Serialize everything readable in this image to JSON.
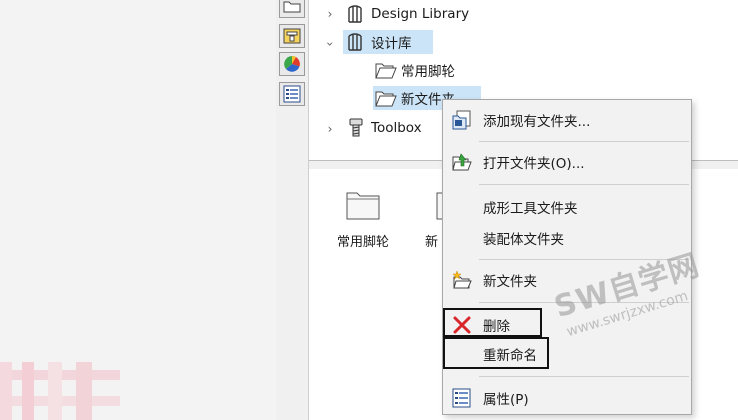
{
  "tree": {
    "items": [
      {
        "label": "Design Library",
        "expanded": false
      },
      {
        "label": "设计库",
        "expanded": true
      },
      {
        "label": "常用脚轮"
      },
      {
        "label": "新文件夹"
      },
      {
        "label": "Toolbox",
        "expanded": false
      }
    ]
  },
  "bottom_pane": {
    "thumbnails": [
      {
        "label": "常用脚轮"
      },
      {
        "label": "新"
      }
    ]
  },
  "context_menu": {
    "items": [
      {
        "label": "添加现有文件夹..."
      },
      {
        "label": "打开文件夹(O)..."
      },
      {
        "label": "成形工具文件夹"
      },
      {
        "label": "装配体文件夹"
      },
      {
        "label": "新文件夹"
      },
      {
        "label": "删除"
      },
      {
        "label": "重新命名"
      },
      {
        "label": "属性(P)"
      }
    ]
  },
  "watermark": {
    "brand": "SW自学网",
    "url": "www.swrjzxw.com"
  },
  "colors": {
    "selection": "#cce4f7",
    "delete_red": "#d9262b",
    "menu_bg": "#f2f2f2"
  }
}
